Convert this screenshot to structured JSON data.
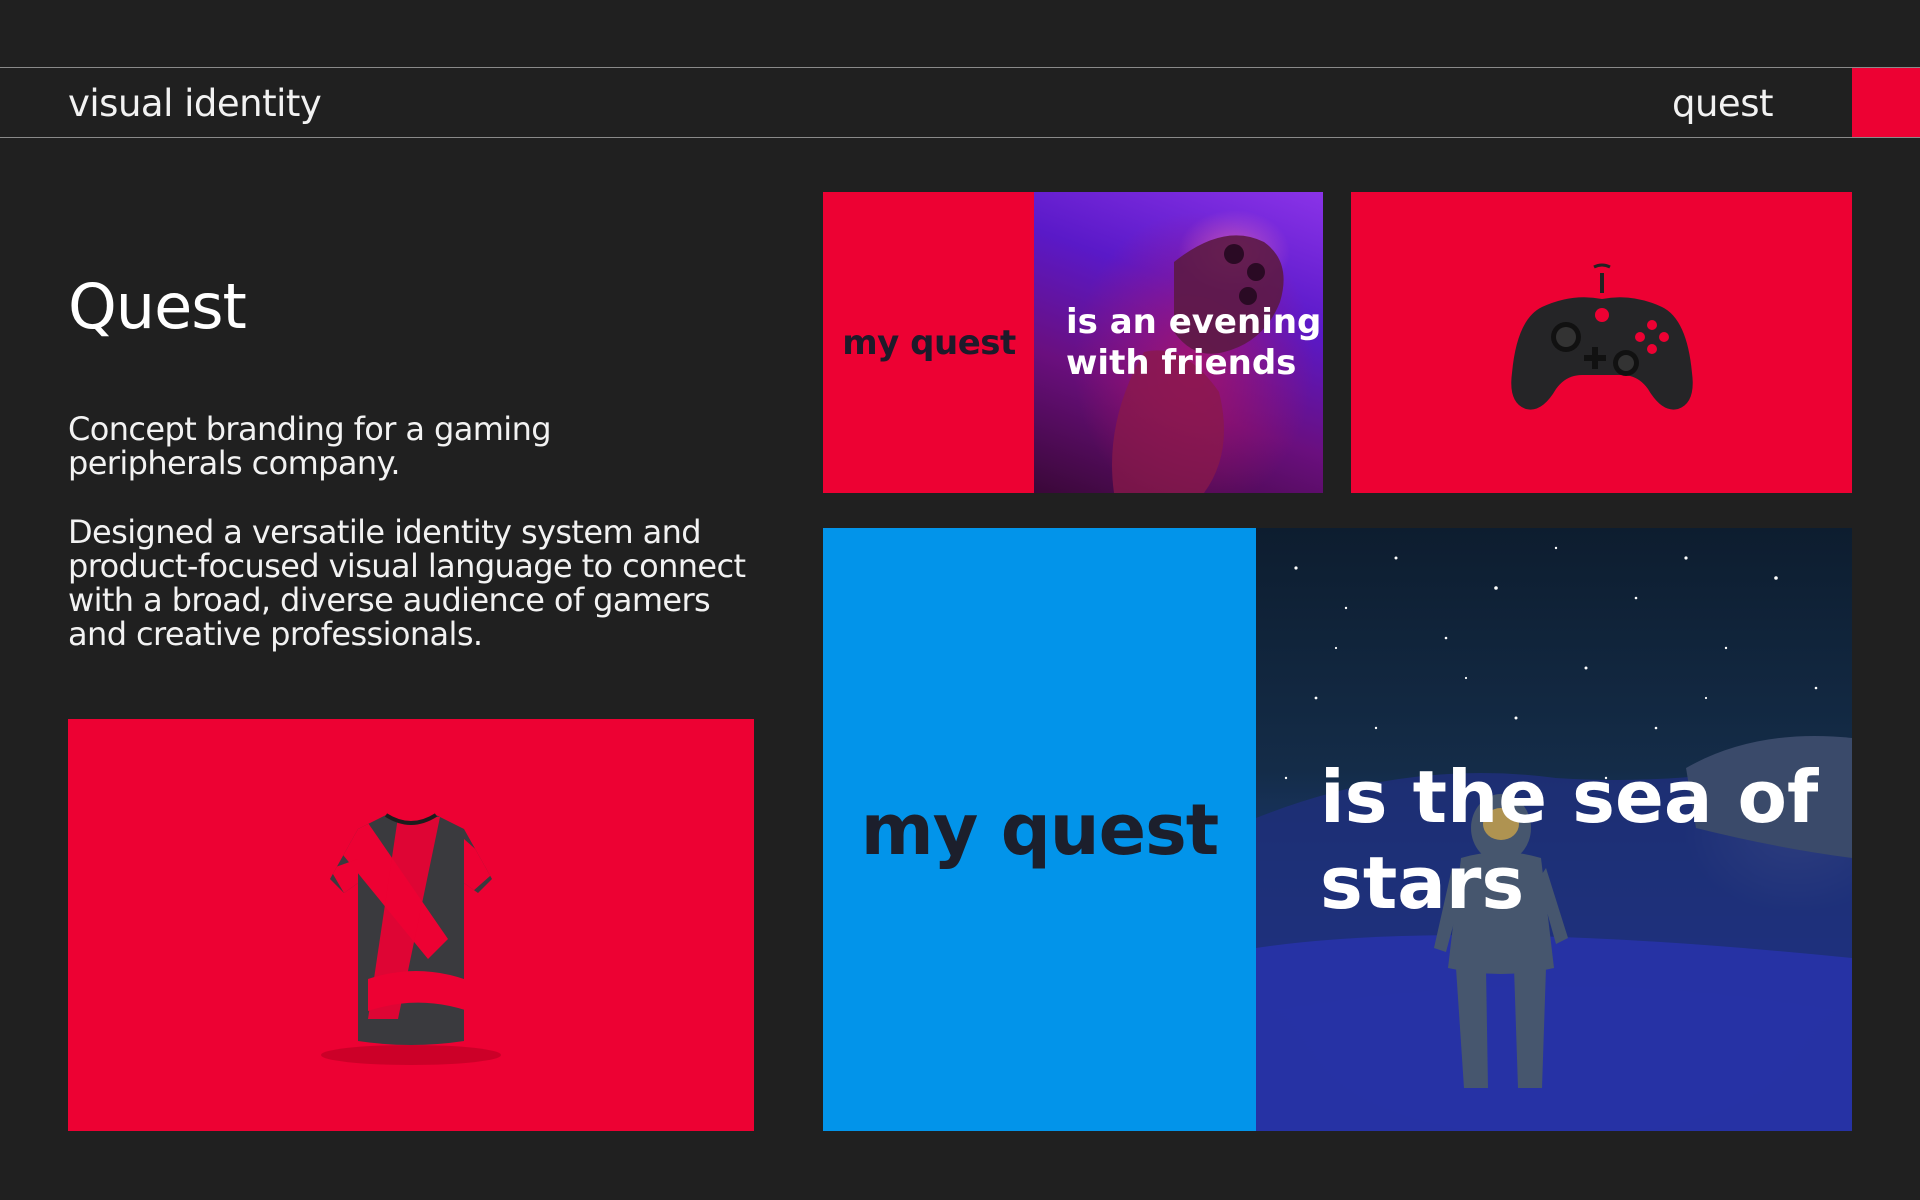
{
  "header": {
    "left_label": "visual identity",
    "right_label": "quest"
  },
  "project": {
    "title": "Quest",
    "paragraph_1": "Concept branding for a gaming peripherals company.",
    "paragraph_2": "Designed a versatile identity system and product-focused visual language to connect with a broad, diverse audience of gamers and creative professionals."
  },
  "tiles": {
    "small_brand": "my quest",
    "small_overlay": "is an evening with friends",
    "big_brand": "my quest",
    "big_overlay": "is the sea of stars"
  },
  "colors": {
    "background": "#202020",
    "brand_red": "#ED0133",
    "brand_blue": "#0294EA"
  },
  "icons": [
    "tshirt-icon",
    "gamepad-icon",
    "controller-icon",
    "astronaut-icon"
  ]
}
